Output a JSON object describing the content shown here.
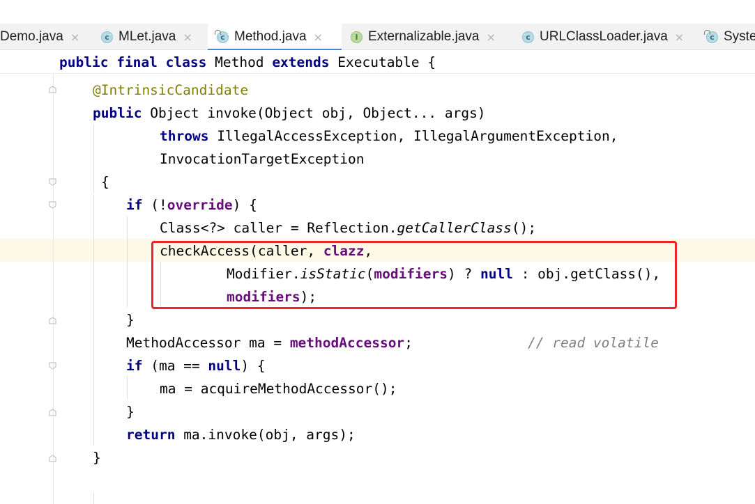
{
  "tabs": [
    {
      "label": "Demo.java",
      "icon": "none",
      "active": false
    },
    {
      "label": "MLet.java",
      "icon": "class-icon",
      "active": false
    },
    {
      "label": "Method.java",
      "icon": "class-lock-icon",
      "active": true
    },
    {
      "label": "Externalizable.java",
      "icon": "interface-icon",
      "active": false
    },
    {
      "label": "URLClassLoader.java",
      "icon": "class-icon",
      "active": false
    },
    {
      "label": "Syste",
      "icon": "class-lock-icon",
      "active": false
    }
  ],
  "icons": {
    "class_letter": "c",
    "interface_letter": "I",
    "close_glyph": "×"
  },
  "code": {
    "header": {
      "kw1": "public",
      "kw2": "final",
      "kw3": "class",
      "name": "Method",
      "kw4": "extends",
      "super": "Executable {"
    },
    "l1": {
      "ann": "@IntrinsicCandidate"
    },
    "l2": {
      "kw": "public",
      "rest": "Object invoke(Object obj, Object... args)"
    },
    "l3": {
      "kw": "throws",
      "rest": "IllegalAccessException, IllegalArgumentException,"
    },
    "l4": {
      "rest": "InvocationTargetException"
    },
    "l5": {
      "rest": "{"
    },
    "l6": {
      "kw": "if",
      "p1": "(!",
      "fld": "override",
      "p2": ") {"
    },
    "l7": {
      "a": "Class<?> caller = Reflection.",
      "it": "getCallerClass",
      "b": "();"
    },
    "l8": {
      "a": "checkAccess(caller, ",
      "fld": "clazz",
      "b": ","
    },
    "l9": {
      "a": "Modifier.",
      "it": "isStatic",
      "p": "(",
      "fld": "modifiers",
      "q": ") ? ",
      "kw": "null",
      "r": " : obj.getClass(),"
    },
    "l10": {
      "fld": "modifiers",
      "b": ");"
    },
    "l11": {
      "rest": "}"
    },
    "l12": {
      "a": "MethodAccessor ma = ",
      "fld": "methodAccessor",
      "b": ";",
      "comment": "// read volatile"
    },
    "l13": {
      "kw": "if",
      "a": " (ma == ",
      "kw2": "null",
      "b": ") {"
    },
    "l14": {
      "rest": "ma = acquireMethodAccessor();"
    },
    "l15": {
      "rest": "}"
    },
    "l16": {
      "kw": "return",
      "rest": " ma.invoke(obj, args);"
    },
    "l17": {
      "rest": "}"
    }
  },
  "colors": {
    "keyword": "#000080",
    "annotation": "#808000",
    "field": "#660e7a",
    "comment": "#808080",
    "highlight_box": "#e8262a",
    "active_tab_underline": "#4a86c8"
  }
}
